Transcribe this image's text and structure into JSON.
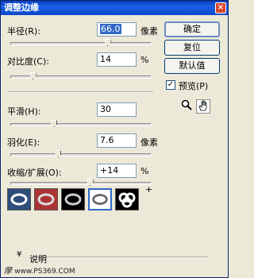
{
  "window": {
    "title": "调整边缘",
    "close": "×"
  },
  "fields": [
    {
      "label": "半径(R):",
      "value": "66.0",
      "unit": "像素",
      "thumb": 0.7
    },
    {
      "label": "对比度(C):",
      "value": "14",
      "unit": "%",
      "thumb": 0.14
    },
    {
      "label": "平滑(H):",
      "value": "30",
      "unit": "",
      "thumb": 0.3
    },
    {
      "label": "羽化(E):",
      "value": "7.6",
      "unit": "像素",
      "thumb": 0.33
    },
    {
      "label": "收缩/扩展(O):",
      "value": "+14",
      "unit": "%",
      "thumb": 0.57
    }
  ],
  "slider_minus": "−",
  "slider_plus": "+",
  "buttons": {
    "ok": "确定",
    "reset": "复位",
    "default": "默认值"
  },
  "preview_checkbox": {
    "label": "预览(P)",
    "checked": true,
    "mark": "✓"
  },
  "tools": [
    "zoom-icon",
    "hand-icon"
  ],
  "preview_modes": [
    "standard",
    "quick-mask",
    "on-black",
    "on-white",
    "mask"
  ],
  "selected_preview": 3,
  "description": {
    "toggle": "¥",
    "label": "说明"
  },
  "watermark": {
    "text": "摩",
    "site": "www.PS369.COM"
  }
}
